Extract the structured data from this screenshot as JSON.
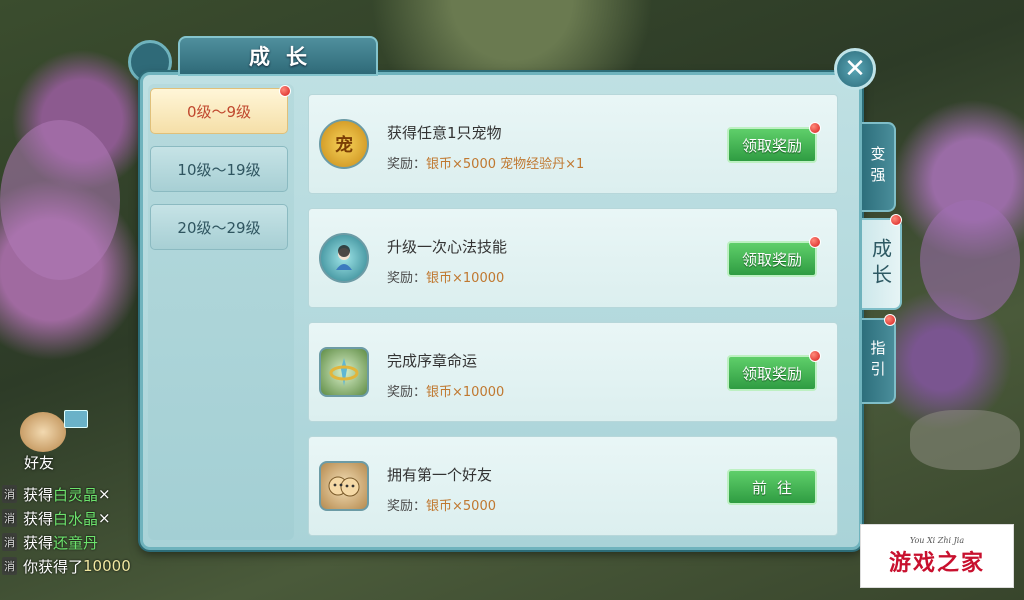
{
  "window": {
    "title": "成长",
    "close_label": "✕"
  },
  "levels": [
    {
      "label": "0级～9级",
      "active": true,
      "has_dot": true
    },
    {
      "label": "10级～19级",
      "active": false,
      "has_dot": false
    },
    {
      "label": "20级～29级",
      "active": false,
      "has_dot": false
    }
  ],
  "tasks": [
    {
      "title": "获得任意1只宠物",
      "reward_prefix": "奖励：",
      "reward_value": "银币×5000  宠物经验丹×1",
      "button": "领取奖励",
      "icon": "pet-icon",
      "icon_text": "宠",
      "has_dot": true
    },
    {
      "title": "升级一次心法技能",
      "reward_prefix": "奖励：",
      "reward_value": "银币×10000",
      "button": "领取奖励",
      "icon": "skill-icon",
      "icon_text": "",
      "has_dot": true
    },
    {
      "title": "完成序章命运",
      "reward_prefix": "奖励：",
      "reward_value": "银币×10000",
      "button": "领取奖励",
      "icon": "fate-icon",
      "icon_text": "",
      "has_dot": true
    },
    {
      "title": "拥有第一个好友",
      "reward_prefix": "奖励：",
      "reward_value": "银币×5000",
      "button": "前往",
      "icon": "friend-icon",
      "icon_text": "",
      "has_dot": false
    }
  ],
  "side_tabs": [
    {
      "label": "变强",
      "active": false
    },
    {
      "label": "成长",
      "active": true
    },
    {
      "label": "指引",
      "active": false
    }
  ],
  "friend": {
    "label": "好友"
  },
  "chat": [
    {
      "tag": "消",
      "prefix": "获得",
      "item": "白灵晶",
      "suffix": "×"
    },
    {
      "tag": "消",
      "prefix": "获得",
      "item": "白水晶",
      "suffix": "×"
    },
    {
      "tag": "消",
      "prefix": "获得",
      "item": "还童丹",
      "suffix": ""
    },
    {
      "tag": "消",
      "prefix": "你获得了",
      "item": "10000",
      "suffix": ""
    }
  ],
  "logo": {
    "small": "You Xi Zhi Jia",
    "main": "游戏之家"
  },
  "colors": {
    "accent_green": "#3fae4f",
    "reward_orange": "#c07830",
    "active_tab": "#f5dfa8",
    "dot_red": "#d61e1e"
  }
}
